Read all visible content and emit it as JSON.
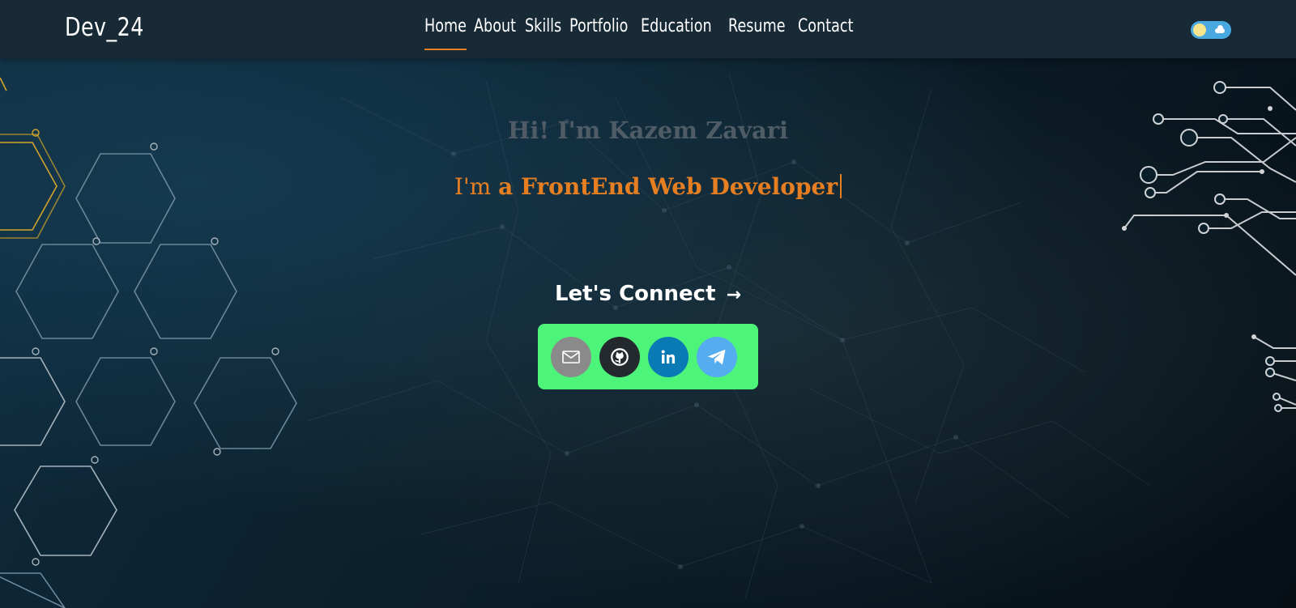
{
  "brand": {
    "logo_text": "Dev_24"
  },
  "nav": {
    "items": [
      {
        "label": "Home",
        "active": true
      },
      {
        "label": "About"
      },
      {
        "label": "Skills"
      },
      {
        "label": "Portfolio"
      },
      {
        "label": "Education"
      },
      {
        "label": "Resume"
      },
      {
        "label": "Contact"
      }
    ],
    "theme_toggle_icon": "sun-cloud-toggle-icon"
  },
  "hero": {
    "greeting": "Hi! I'm Kazem Zavari",
    "role_prefix": "I'm",
    "role": "a FrontEnd Web Developer"
  },
  "connect": {
    "title": "Let's Connect",
    "arrow": "→",
    "links": [
      {
        "name": "email",
        "icon": "mail-icon"
      },
      {
        "name": "github",
        "icon": "github-icon"
      },
      {
        "name": "linkedin",
        "icon": "linkedin-icon"
      },
      {
        "name": "telegram",
        "icon": "telegram-icon"
      }
    ]
  },
  "colors": {
    "accent": "#e67e22",
    "navbar": "#172a36",
    "social_box": "#4cf57a",
    "email": "#8a8a8a",
    "github": "#24292e",
    "linkedin": "#0a7ab5",
    "telegram": "#55acee"
  }
}
